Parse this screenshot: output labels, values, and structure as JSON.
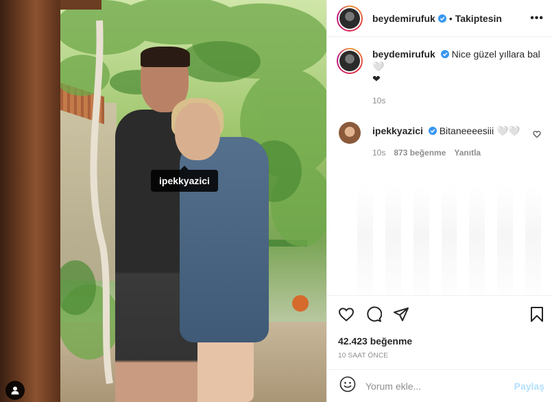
{
  "photo": {
    "tag": "ipekkyazici",
    "tags_icon": "user-tag-icon"
  },
  "header": {
    "username": "beydemirufuk",
    "separator": "•",
    "follow_state": "Takiptesin",
    "more": "•••"
  },
  "caption": {
    "username": "beydemirufuk",
    "text": "Nice güzel yıllara bal 🤍",
    "text2": "❤",
    "time": "10s"
  },
  "reply": {
    "username": "ipekkyazici",
    "text": "Bitaneeeesiii 🤍🤍",
    "time": "10s",
    "likes": "873 beğenme",
    "reply_label": "Yanıtla"
  },
  "actions": {
    "likes": "42.423 beğenme",
    "time": "10 SAAT ÖNCE"
  },
  "comment_box": {
    "placeholder": "Yorum ekle...",
    "post_label": "Paylaş"
  },
  "colors": {
    "verified": "#3897f0",
    "link_disabled": "#b2dffc",
    "muted": "#8e8e8e"
  }
}
